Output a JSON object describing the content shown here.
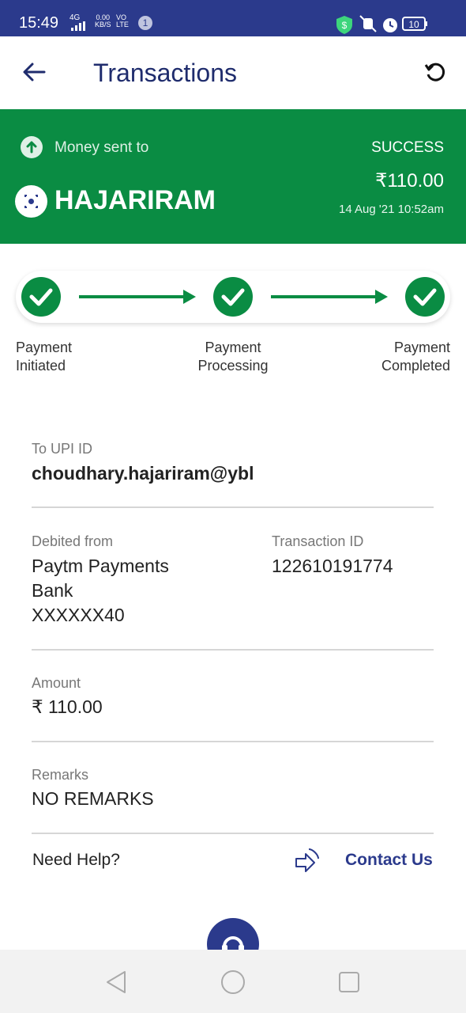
{
  "status_bar": {
    "time": "15:49",
    "network": "4G",
    "speed_value": "0.00",
    "speed_unit": "KB/S",
    "volte_top": "VO",
    "volte_bottom": "LTE",
    "notification_count": "1",
    "battery": "10"
  },
  "header": {
    "title": "Transactions"
  },
  "summary": {
    "label": "Money sent to",
    "recipient": "HAJARIRAM",
    "status": "SUCCESS",
    "amount": "₹110.00",
    "datetime": "14 Aug '21 10:52am"
  },
  "steps": [
    {
      "line1": "Payment",
      "line2": "Initiated"
    },
    {
      "line1": "Payment",
      "line2": "Processing"
    },
    {
      "line1": "Payment",
      "line2": "Completed"
    }
  ],
  "details": {
    "to_upi_label": "To UPI ID",
    "to_upi_value": "choudhary.hajariram@ybl",
    "debited_label": "Debited from",
    "debited_line1": "Paytm Payments",
    "debited_line2": "Bank",
    "debited_line3": "XXXXXX40",
    "txn_label": "Transaction ID",
    "txn_value": "122610191774",
    "amount_label": "Amount",
    "amount_value": "₹ 110.00",
    "remarks_label": "Remarks",
    "remarks_value": "NO REMARKS"
  },
  "help": {
    "text": "Need Help?",
    "contact": "Contact Us"
  },
  "colors": {
    "primary": "#2b3a8c",
    "success": "#0a8c43"
  }
}
